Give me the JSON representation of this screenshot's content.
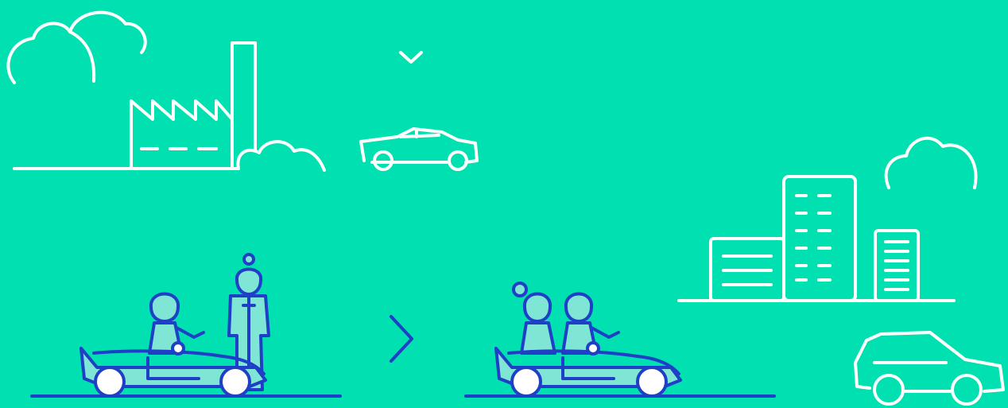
{
  "scene": {
    "background_color": "#00e0b0",
    "line_color_light": "#ffffff",
    "line_color_dark": "#1f3fc7",
    "icons": [
      "cloud-icon",
      "factory-icon",
      "chevron-down-icon",
      "sedan-car-icon",
      "city-buildings-icon",
      "suv-car-icon",
      "convertible-driver-and-pedestrian-icon",
      "chevron-right-icon",
      "convertible-carpool-icon"
    ]
  }
}
